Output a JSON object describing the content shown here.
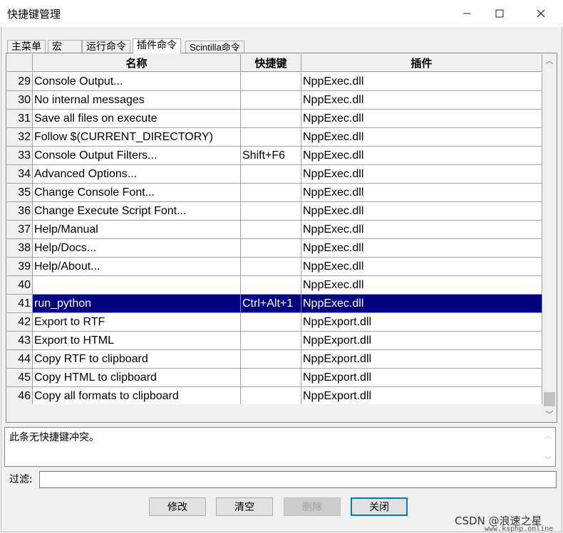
{
  "window": {
    "title": "快捷键管理",
    "minimize_glyph": "—",
    "maximize_glyph": "☐",
    "close_glyph": "✕"
  },
  "tabs": [
    {
      "label": "主菜单",
      "active": false
    },
    {
      "label": "宏",
      "active": false
    },
    {
      "label": "运行命令",
      "active": false
    },
    {
      "label": "插件命令",
      "active": true
    },
    {
      "label": "Scintilla命令",
      "active": false
    }
  ],
  "table": {
    "columns": [
      "名称",
      "快捷键",
      "插件"
    ],
    "selected_row": 41,
    "rows": [
      {
        "num": "29",
        "name": "Console Output...",
        "shortcut": "",
        "plugin": "NppExec.dll"
      },
      {
        "num": "30",
        "name": "No internal messages",
        "shortcut": "",
        "plugin": "NppExec.dll"
      },
      {
        "num": "31",
        "name": "Save all files on execute",
        "shortcut": "",
        "plugin": "NppExec.dll"
      },
      {
        "num": "32",
        "name": "Follow $(CURRENT_DIRECTORY)",
        "shortcut": "",
        "plugin": "NppExec.dll"
      },
      {
        "num": "33",
        "name": "Console Output Filters...",
        "shortcut": "Shift+F6",
        "plugin": "NppExec.dll"
      },
      {
        "num": "34",
        "name": "Advanced Options...",
        "shortcut": "",
        "plugin": "NppExec.dll"
      },
      {
        "num": "35",
        "name": "Change Console Font...",
        "shortcut": "",
        "plugin": "NppExec.dll"
      },
      {
        "num": "36",
        "name": "Change Execute Script Font...",
        "shortcut": "",
        "plugin": "NppExec.dll"
      },
      {
        "num": "37",
        "name": "Help/Manual",
        "shortcut": "",
        "plugin": "NppExec.dll"
      },
      {
        "num": "38",
        "name": "Help/Docs...",
        "shortcut": "",
        "plugin": "NppExec.dll"
      },
      {
        "num": "39",
        "name": "Help/About...",
        "shortcut": "",
        "plugin": "NppExec.dll"
      },
      {
        "num": "40",
        "name": "",
        "shortcut": "",
        "plugin": "NppExec.dll"
      },
      {
        "num": "41",
        "name": "run_python",
        "shortcut": "Ctrl+Alt+1",
        "plugin": "NppExec.dll"
      },
      {
        "num": "42",
        "name": "Export to RTF",
        "shortcut": "",
        "plugin": "NppExport.dll"
      },
      {
        "num": "43",
        "name": "Export to HTML",
        "shortcut": "",
        "plugin": "NppExport.dll"
      },
      {
        "num": "44",
        "name": "Copy RTF to clipboard",
        "shortcut": "",
        "plugin": "NppExport.dll"
      },
      {
        "num": "45",
        "name": "Copy HTML to clipboard",
        "shortcut": "",
        "plugin": "NppExport.dll"
      },
      {
        "num": "46",
        "name": "Copy all formats to clipboard",
        "shortcut": "",
        "plugin": "NppExport.dll"
      }
    ],
    "scrollbar": {
      "up_glyph": "︿",
      "down_glyph": "﹀"
    }
  },
  "message": {
    "text": "此条无快捷键冲突。",
    "up_glyph": "︿",
    "down_glyph": "﹀"
  },
  "filter": {
    "label": "过滤:",
    "value": ""
  },
  "buttons": {
    "modify": "修改",
    "clear": "清空",
    "delete": "删除",
    "close": "关闭"
  },
  "watermark": {
    "text": "CSDN @浪速之星",
    "site": "www.ksphp.online"
  },
  "colors": {
    "selection": "#000080",
    "window_bg": "#f0f0f0",
    "default_button_border": "#0078d7"
  }
}
